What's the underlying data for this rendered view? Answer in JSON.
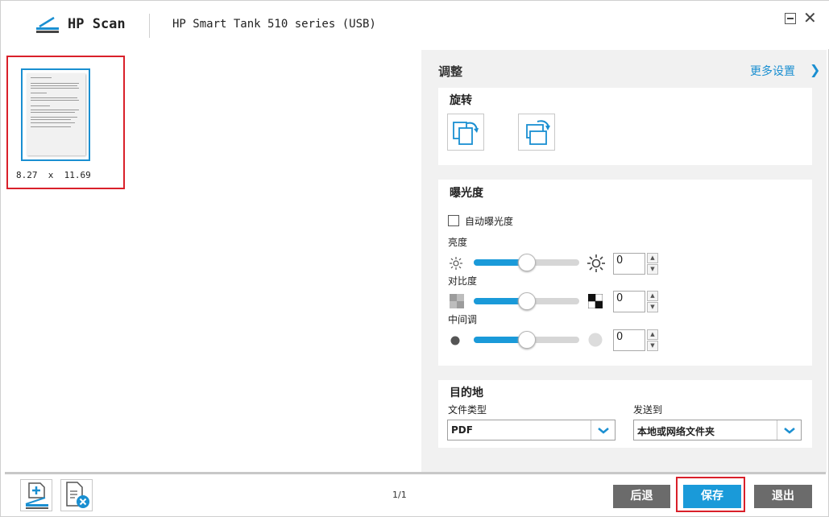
{
  "header": {
    "app_name": "HP Scan",
    "device_name": "HP Smart Tank 510 series (USB)"
  },
  "preview": {
    "page_size": "8.27  x  11.69"
  },
  "panel": {
    "title": "调整",
    "more_settings": "更多设置",
    "rotate": {
      "title": "旋转"
    },
    "exposure": {
      "title": "曝光度",
      "auto_label": "自动曝光度",
      "auto_checked": false,
      "brightness": {
        "label": "亮度",
        "value": "0",
        "level": 0.5
      },
      "contrast": {
        "label": "对比度",
        "value": "0",
        "level": 0.5
      },
      "midtone": {
        "label": "中间调",
        "value": "0",
        "level": 0.5
      }
    },
    "destination": {
      "title": "目的地",
      "file_type_label": "文件类型",
      "file_type_value": "PDF",
      "send_to_label": "发送到",
      "send_to_value": "本地或网络文件夹"
    }
  },
  "footer": {
    "page_count": "1/1",
    "back_label": "后退",
    "save_label": "保存",
    "exit_label": "退出"
  },
  "colors": {
    "accent": "#1a9ad9",
    "highlight_red": "#d9202a",
    "button_gray": "#6b6b6b"
  }
}
